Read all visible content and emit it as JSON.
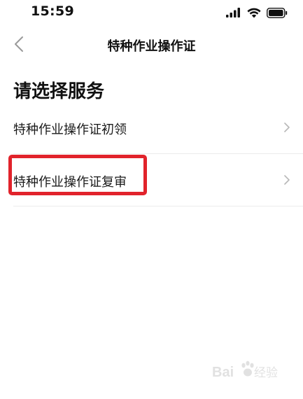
{
  "status_bar": {
    "time": "15:59",
    "icons": [
      "signal-icon",
      "wifi-icon",
      "battery-icon"
    ]
  },
  "nav": {
    "back_icon": "chevron-left-icon",
    "title": "特种作业操作证"
  },
  "page": {
    "heading": "请选择服务",
    "items": [
      {
        "label": "特种作业操作证初领",
        "icon": "chevron-right-icon"
      },
      {
        "label": "特种作业操作证复审",
        "icon": "chevron-right-icon"
      }
    ]
  },
  "annotation": {
    "highlight_color": "#e1232b"
  },
  "watermark": {
    "text": "Baidu 经验"
  },
  "colors": {
    "background": "#ffffff",
    "text": "#111111",
    "divider": "#ececec",
    "chevron": "#b8b8b8"
  }
}
